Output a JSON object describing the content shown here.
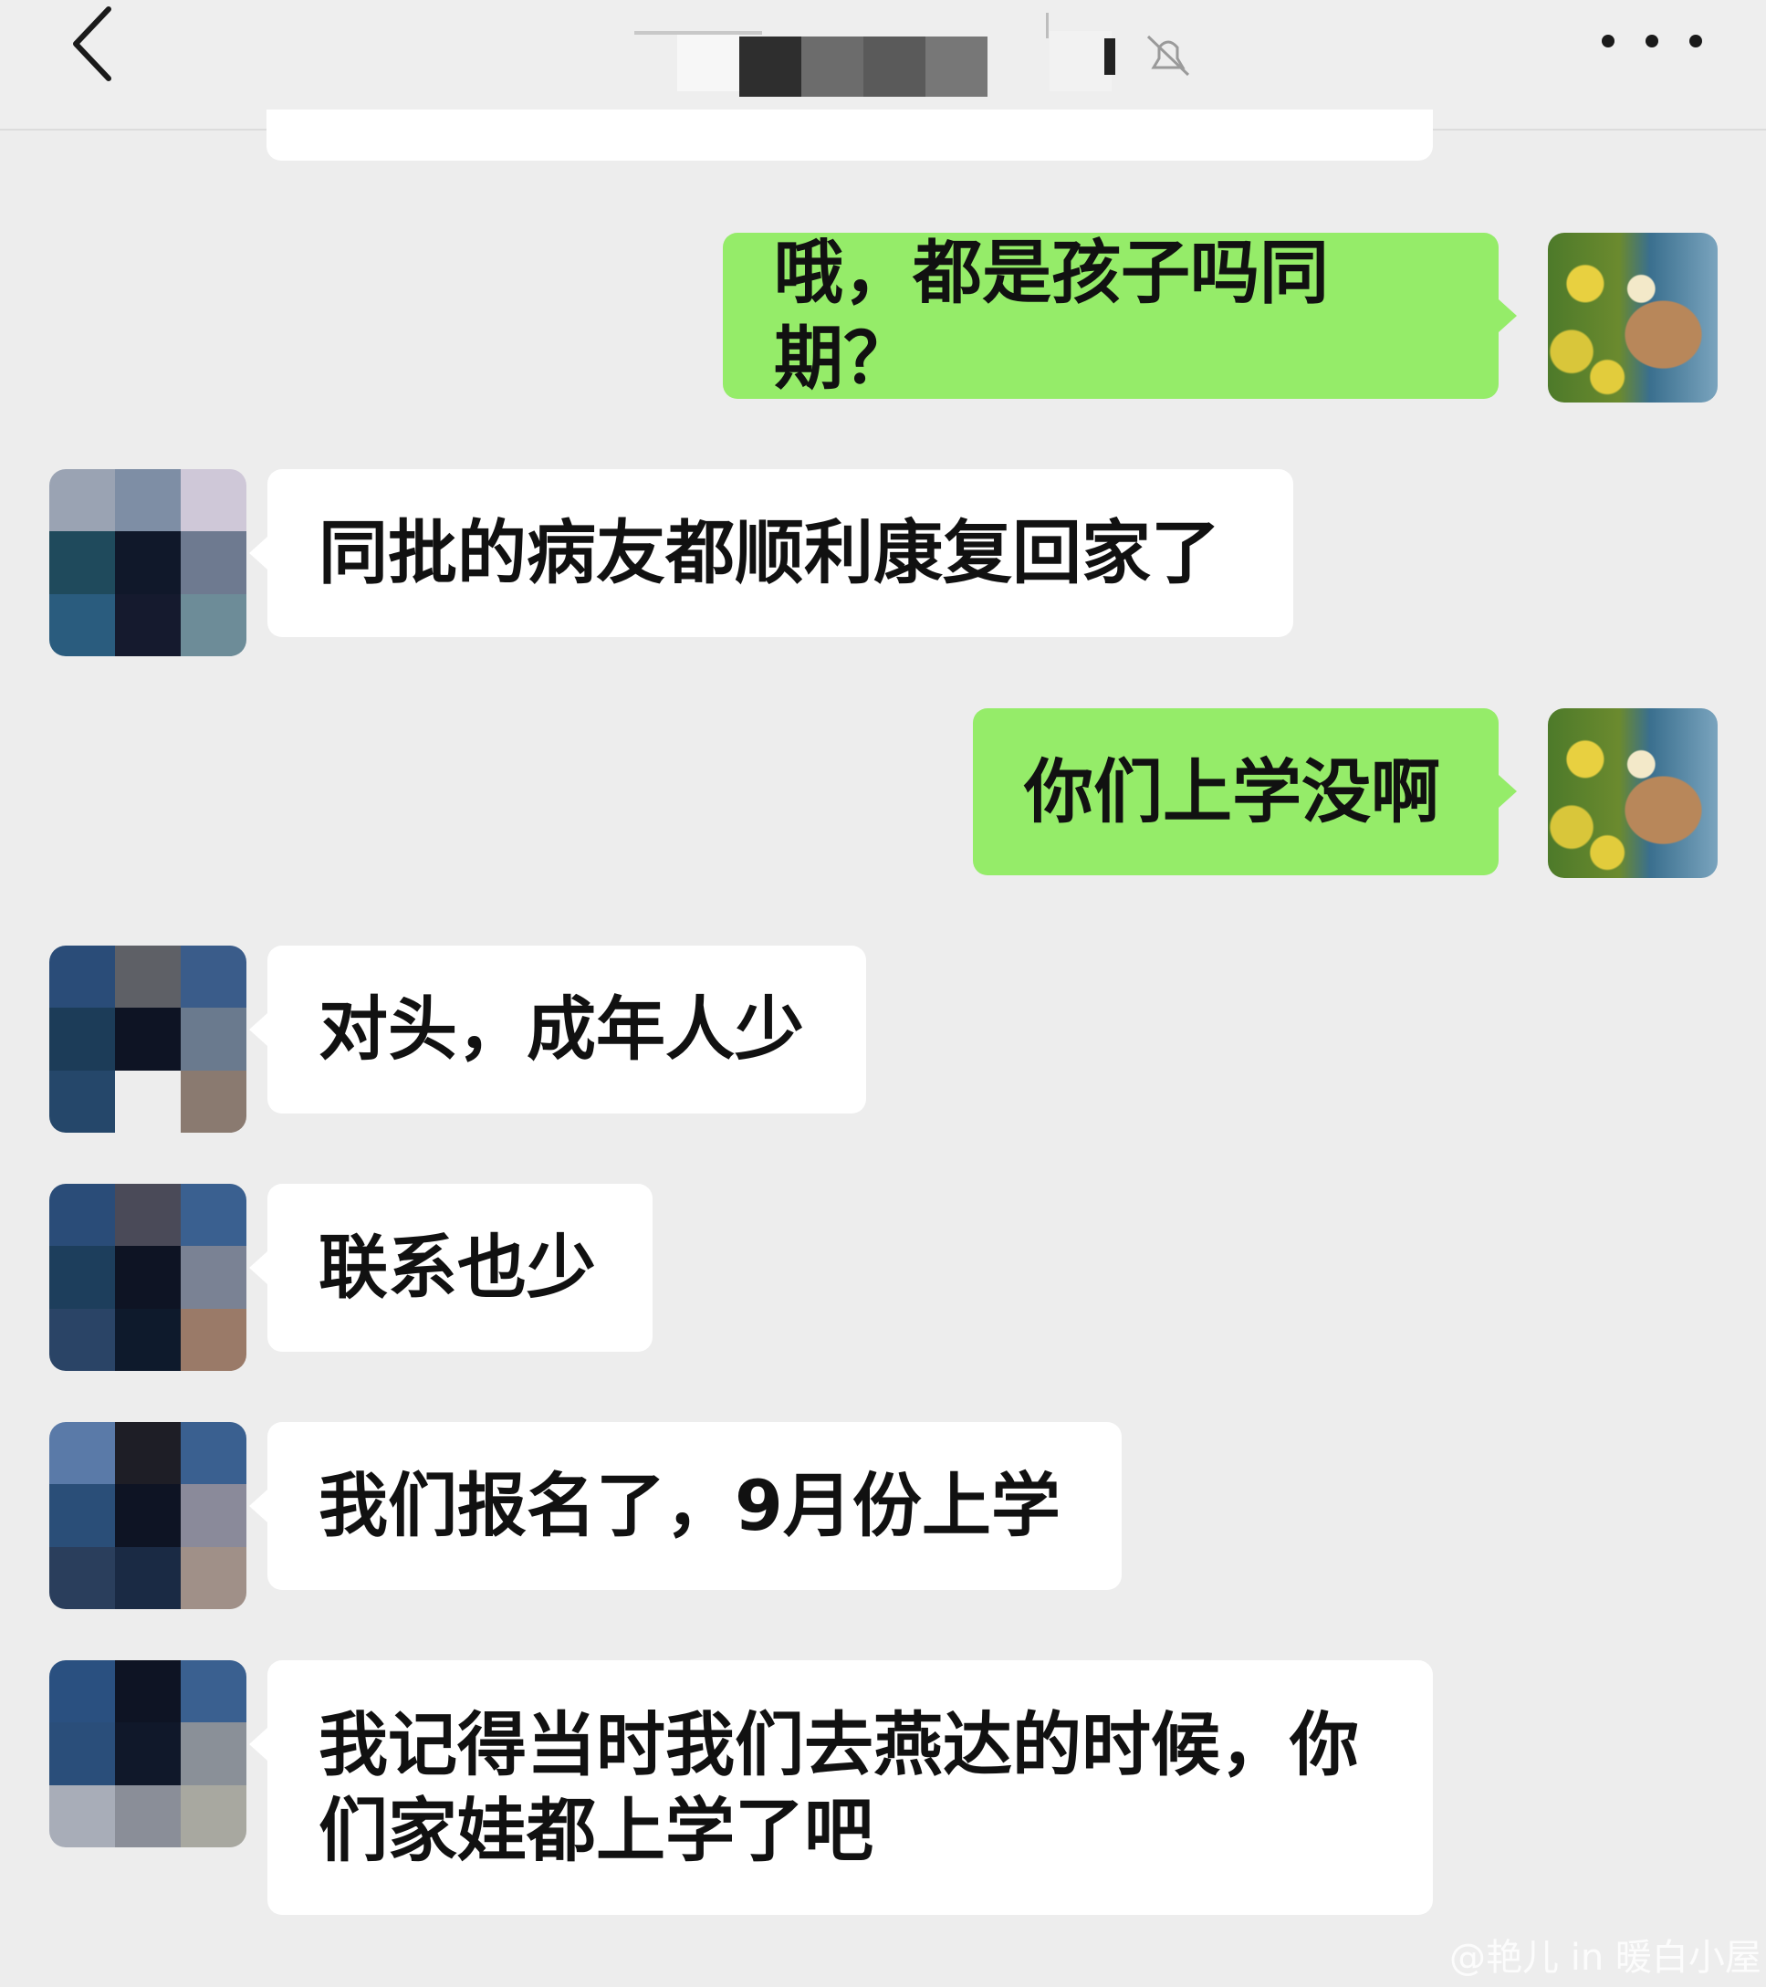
{
  "header": {
    "back_icon": "chevron-left-icon",
    "more_icon": "more-dots-icon"
  },
  "messages": [
    {
      "side": "right",
      "text": "哦，都是孩子吗同期？"
    },
    {
      "side": "left",
      "text": "同批的病友都顺利康复回家了"
    },
    {
      "side": "right",
      "text": "你们上学没啊"
    },
    {
      "side": "left",
      "text": "对头，成年人少"
    },
    {
      "side": "left",
      "text": "联系也少"
    },
    {
      "side": "left",
      "text": "我们报名了，9月份上学"
    },
    {
      "side": "left",
      "text": "我记得当时我们去燕达的时候，你们家娃都上学了吧"
    }
  ],
  "watermark": "@艳儿 in 暖白小屋",
  "colors": {
    "background": "#ededed",
    "self_bubble": "#95ec69",
    "other_bubble": "#ffffff"
  }
}
